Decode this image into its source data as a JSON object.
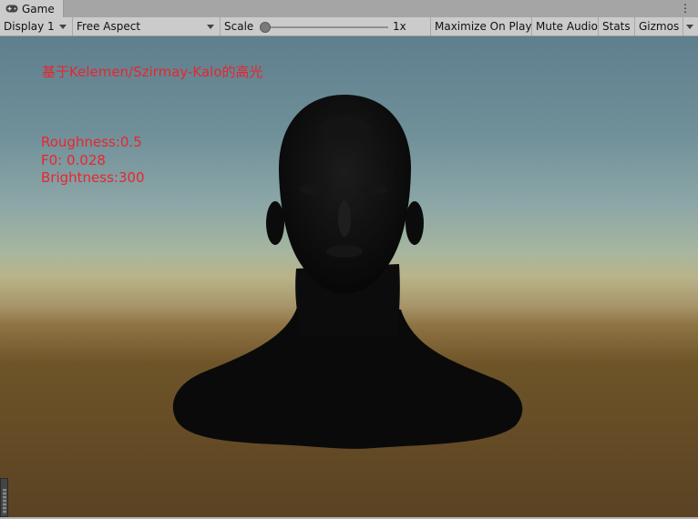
{
  "tab": {
    "label": "Game",
    "icon": "gamepad-icon",
    "menu_icon": "kebab-menu-icon",
    "menu_glyph": "⋮"
  },
  "toolbar": {
    "display": "Display 1",
    "aspect": "Free Aspect",
    "scale_label": "Scale",
    "scale_value": "1x",
    "maximize": "Maximize On Play",
    "mute": "Mute Audio",
    "stats": "Stats",
    "gizmos": "Gizmos"
  },
  "overlay": {
    "title": "基于Kelemen/Szirmay-Kalo的高光",
    "roughness": "Roughness:0.5",
    "f0": "F0: 0.028",
    "brightness": "Brightness:300"
  },
  "colors": {
    "overlay_text": "#e8262e",
    "head": "#0b0b0b"
  }
}
